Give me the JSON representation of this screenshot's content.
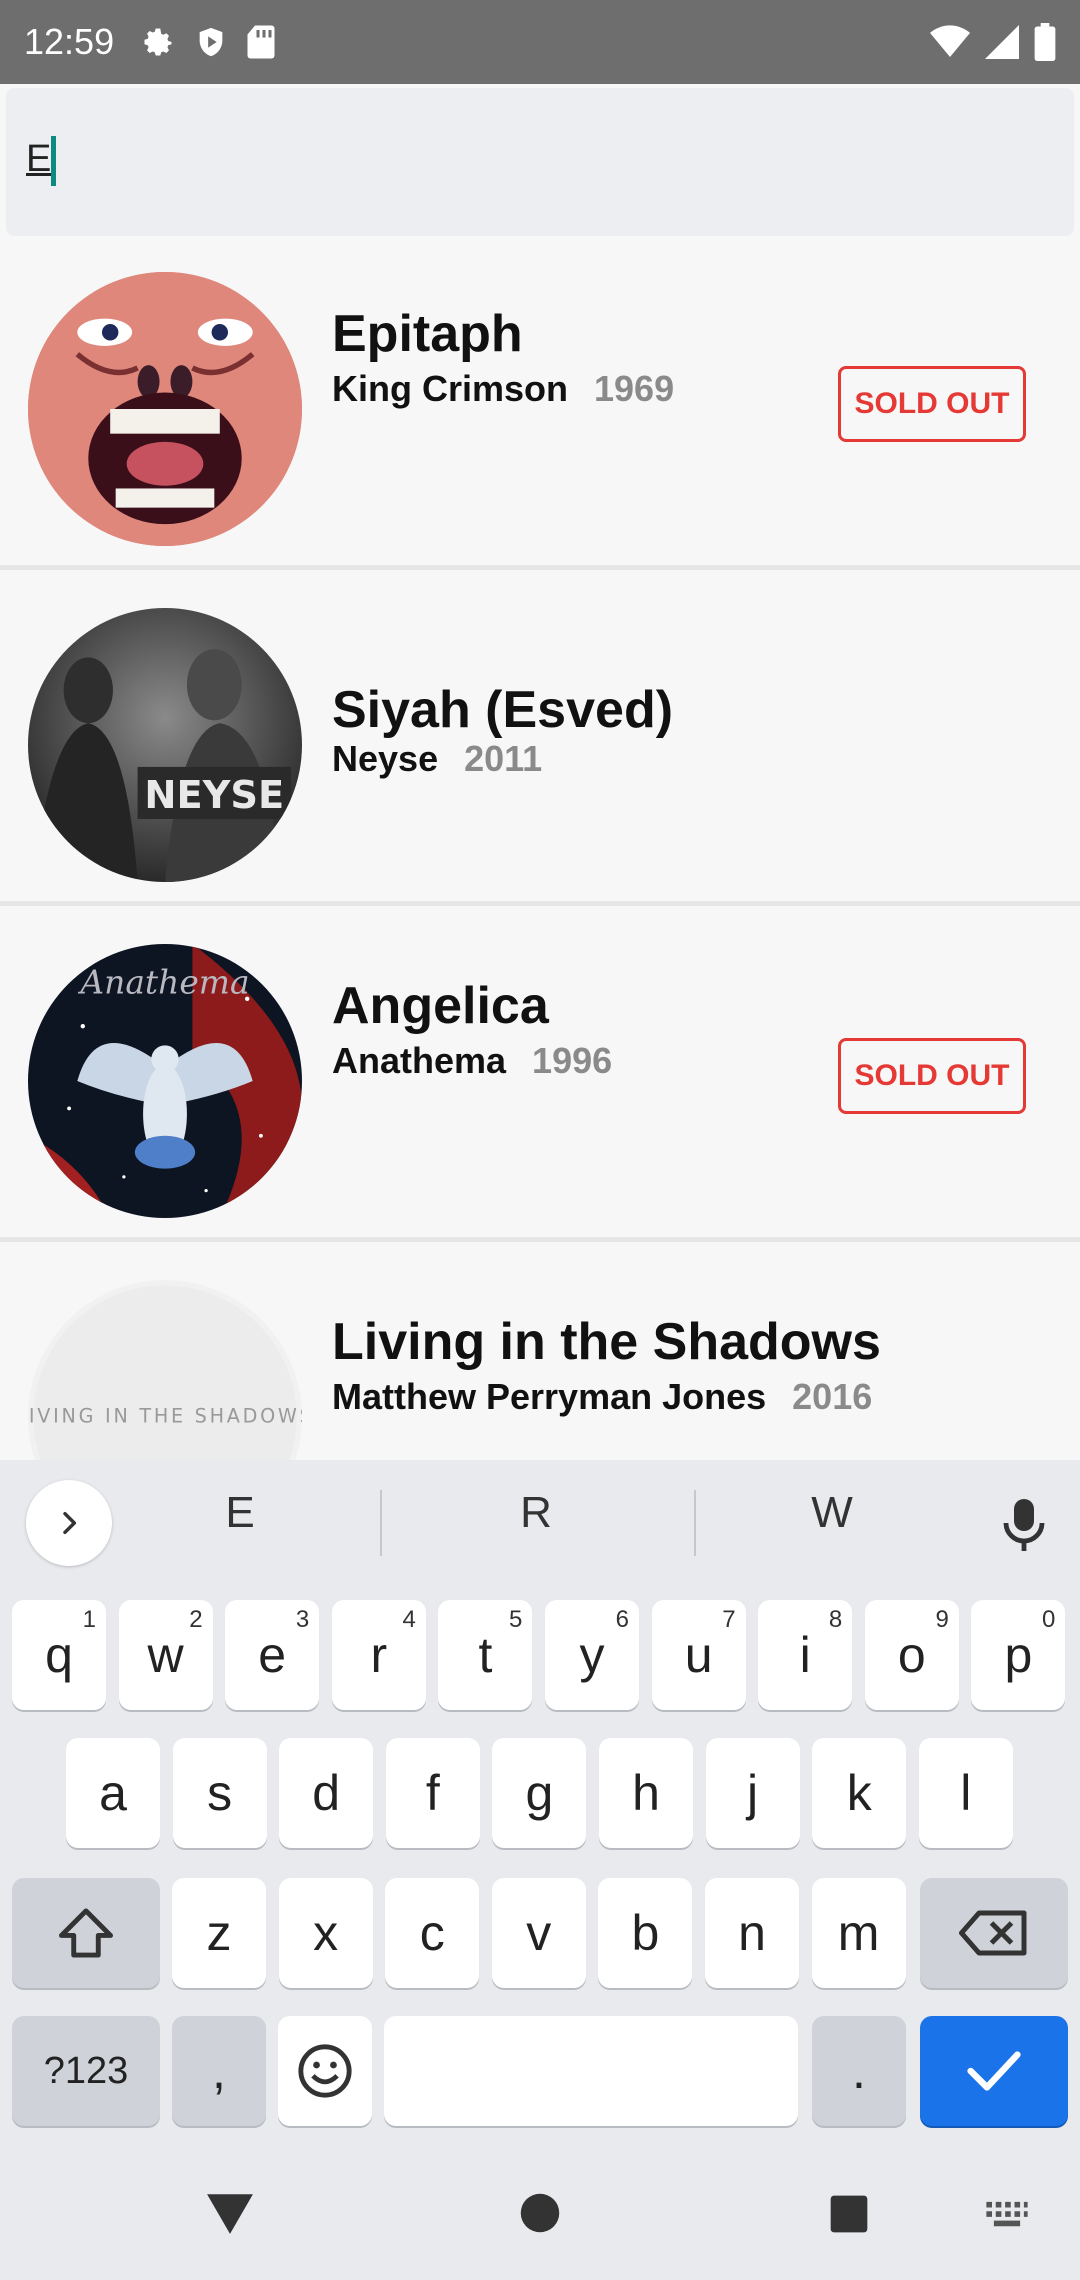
{
  "status_bar": {
    "time": "12:59",
    "left_icons": [
      "settings-icon",
      "play-protect-icon",
      "sd-card-icon"
    ],
    "right_icons": [
      "wifi-icon",
      "signal-icon",
      "battery-icon"
    ]
  },
  "search": {
    "value": "E"
  },
  "albums": [
    {
      "title": "Epitaph",
      "artist": "King Crimson",
      "year": "1969",
      "badge": "SOLD OUT",
      "art": "king-crimson-album-art"
    },
    {
      "title": "Siyah (Esved)",
      "artist": "Neyse",
      "year": "2011",
      "badge": "",
      "art": "neyse-album-art",
      "art_text": "NEYSE"
    },
    {
      "title": "Angelica",
      "artist": "Anathema",
      "year": "1996",
      "badge": "SOLD OUT",
      "art": "anathema-album-art",
      "art_text": "Anathema"
    },
    {
      "title": "Living in the Shadows",
      "artist": "Matthew Perryman Jones",
      "year": "2016",
      "badge": "",
      "art": "living-in-the-shadows-album-art",
      "art_text": "LIVING IN THE SHADOWS"
    }
  ],
  "keyboard": {
    "suggestions": [
      "E",
      "R",
      "W"
    ],
    "row1": [
      {
        "k": "q",
        "h": "1"
      },
      {
        "k": "w",
        "h": "2"
      },
      {
        "k": "e",
        "h": "3"
      },
      {
        "k": "r",
        "h": "4"
      },
      {
        "k": "t",
        "h": "5"
      },
      {
        "k": "y",
        "h": "6"
      },
      {
        "k": "u",
        "h": "7"
      },
      {
        "k": "i",
        "h": "8"
      },
      {
        "k": "o",
        "h": "9"
      },
      {
        "k": "p",
        "h": "0"
      }
    ],
    "row2": [
      "a",
      "s",
      "d",
      "f",
      "g",
      "h",
      "j",
      "k",
      "l"
    ],
    "row3": [
      "z",
      "x",
      "c",
      "v",
      "b",
      "n",
      "m"
    ],
    "symbols_label": "?123",
    "comma": ",",
    "period": "."
  },
  "colors": {
    "accent": "#1a73e8",
    "sold_out": "#e53935",
    "cursor": "#0f8a80",
    "status_bar": "#6e6e6e"
  }
}
